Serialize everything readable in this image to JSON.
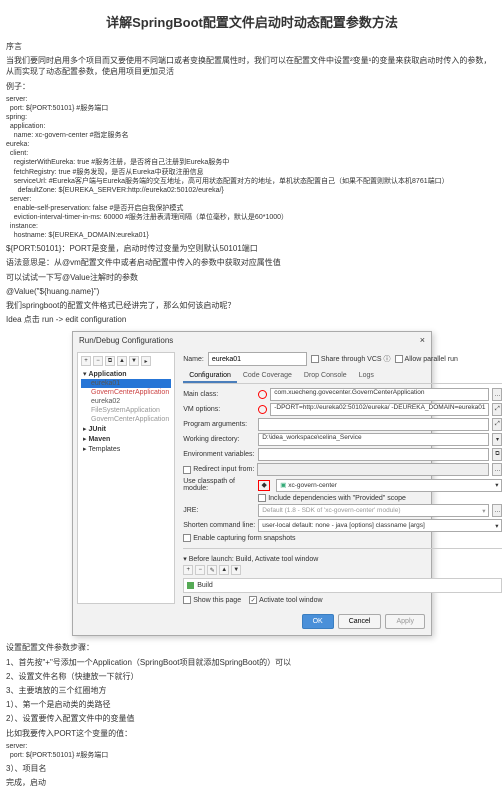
{
  "title": "详解SpringBoot配置文件启动时动态配置参数方法",
  "preface_h": "序言",
  "preface": "当我们要同时启用多个项目而又要使用不同端口或者变换配置属性时，我们可以在配置文件中设置²变量¹的变量来获取启动时传入的参数，从而实现了动态配置参数，使启用项目更加灵活",
  "example_h": "例子：",
  "code1": "server:\n  port: ${PORT:50101} #服务端口\nspring:\n  application:\n    name: xc-govern-center #指定服务名\neureka:\n  client:\n    registerWithEureka: true #服务注册，是否将自己注册到Eureka服务中\n    fetchRegistry: true #服务发现，是否从Eureka中获取注册信息\n    serviceUrl: #Eureka客户端与Eureka服务端的交互地址，高可用状态配置对方的地址，单机状态配置自己（如果不配置则默认本机8761端口）\n      defaultZone: ${EUREKA_SERVER:http://eureka02:50102/eureka/}\n  server:\n    enable-self-preservation: false #是否开启自我保护模式\n    eviction-interval-timer-in-ms: 60000 #服务注册表清理间隔（单位毫秒，默认是60*1000）\n  instance:\n    hostname: ${EUREKA_DOMAIN:eureka01}",
  "explain1": "${PORT:50101}：PORT是变量，启动时传过变量为空则默认50101端口",
  "explain2": "语法意思是：从@vm配置文件中或者启动配置中传入的参数中获取对应属性值",
  "explain3": "可以试试一下写@Value注解时的参数",
  "explain4": "@Value(\"${huang.name}\")",
  "q": "我们springboot的配置文件格式已经讲完了，那么如何该启动呢？",
  "idea": "Idea 点击 run -> edit configuration",
  "dialog": {
    "title": "Run/Debug Configurations",
    "tree_app": "Application",
    "tree_items": [
      "eureka01",
      "GovernCenterApplication",
      "eureka02",
      "FileSystemApplication",
      "GovernCenterApplication"
    ],
    "tree_junit": "JUnit",
    "tree_maven": "Maven",
    "tree_tpl": "Templates",
    "name_lbl": "Name:",
    "name_val": "eureka01",
    "share": "Share through VCS",
    "allow": "Allow parallel run",
    "tabs": [
      "Configuration",
      "Code Coverage",
      "Drop Console",
      "Logs"
    ],
    "mainclass_lbl": "Main class:",
    "mainclass": "com.xuecheng.govecenter.GovernCenterApplication",
    "vm_lbl": "VM options:",
    "vm": "-DPORT=http://eureka02:50102/eureka/ -DEUREKA_DOMAIN=eureka01",
    "prog_lbl": "Program arguments:",
    "work_lbl": "Working directory:",
    "work": "D:\\idea_workspace\\celina_Service",
    "env_lbl": "Environment variables:",
    "redir": "Redirect input from:",
    "classpath_lbl": "Use classpath of module:",
    "classpath": "xc-govern-center",
    "incl_dep": "Include dependencies with \"Provided\" scope",
    "jre_lbl": "JRE:",
    "jre": "Default (1.8 - SDK of 'xc-govern-center' module)",
    "shorten_lbl": "Shorten command line:",
    "shorten": "user-local default: none - java [options] classname [args]",
    "enable_cap": "Enable capturing form snapshots",
    "before": "Before launch: Build, Activate tool window",
    "build": "Build",
    "show_page": "Show this page",
    "activate": "Activate tool window",
    "ok": "OK",
    "cancel": "Cancel",
    "apply": "Apply"
  },
  "steps_h": "设置配置文件参数步骤：",
  "step1": "1、首先按\"+\"号添加一个Application（SpringBoot项目就添加SpringBoot的）可以",
  "step2": "2、设置文件名称（快捷放一下就行）",
  "step3": "3、主要填放的三个红圈地方",
  "step3_1": "1）、第一个是启动类的类路径",
  "step3_2": "2）、设置要传入配置文件中的变量值",
  "note": "比如我要传入PORT这个变量的值：",
  "code2": "server:\n  port: ${PORT:50101} #服务端口",
  "step3_3": "3）、项目名",
  "done": "完成，启动"
}
